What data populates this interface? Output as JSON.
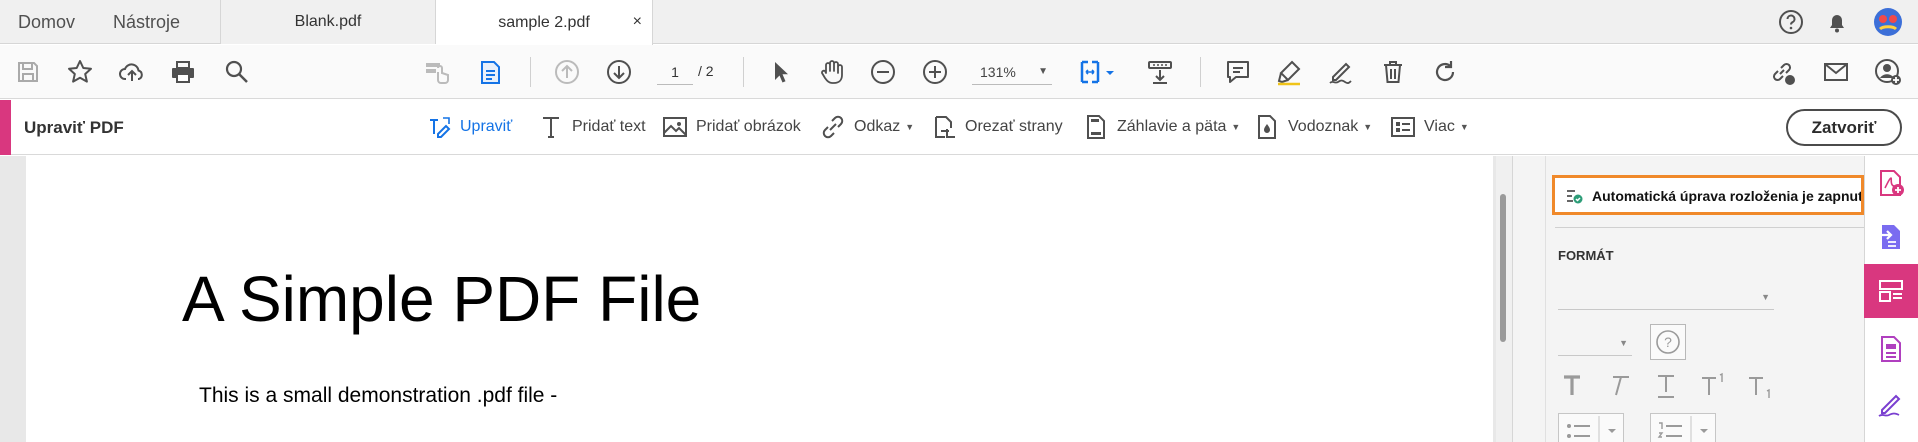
{
  "nav": {
    "home": "Domov",
    "tools": "Nástroje"
  },
  "tabs": [
    {
      "label": "Blank.pdf"
    },
    {
      "label": "sample 2.pdf",
      "close": "×"
    }
  ],
  "toolbar": {
    "page_current": "1",
    "page_total": "/ 2",
    "zoom": "131%"
  },
  "edit_bar": {
    "title": "Upraviť PDF",
    "tools": {
      "edit": "Upraviť",
      "add_text": "Pridať text",
      "add_image": "Pridať obrázok",
      "link": "Odkaz",
      "crop": "Orezať strany",
      "header_footer": "Záhlavie a päta",
      "watermark": "Vodoznak",
      "more": "Viac"
    },
    "close": "Zatvoriť"
  },
  "document": {
    "title": "A Simple PDF File",
    "text": "This is a small demonstration .pdf file -"
  },
  "panel": {
    "layout_toggle": "Automatická úprava rozloženia je zapnutá",
    "format_label": "FORMÁT",
    "help_glyph": "?"
  },
  "colors": {
    "accent": "#d9377f",
    "highlight": "#f0892a",
    "link_blue": "#1473e6",
    "icon_gray": "#505050"
  }
}
